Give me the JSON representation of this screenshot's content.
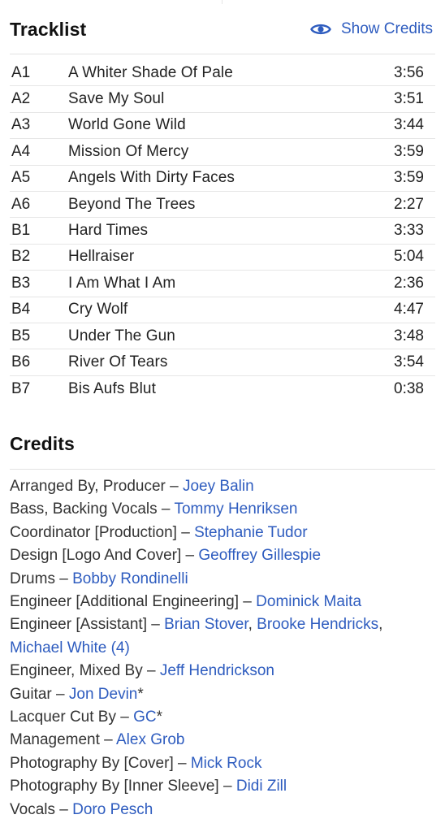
{
  "tracklist": {
    "title": "Tracklist",
    "show_credits_label": "Show Credits",
    "tracks": [
      {
        "position": "A1",
        "title": "A Whiter Shade Of Pale",
        "duration": "3:56"
      },
      {
        "position": "A2",
        "title": "Save My Soul",
        "duration": "3:51"
      },
      {
        "position": "A3",
        "title": "World Gone Wild",
        "duration": "3:44"
      },
      {
        "position": "A4",
        "title": "Mission Of Mercy",
        "duration": "3:59"
      },
      {
        "position": "A5",
        "title": "Angels With Dirty Faces",
        "duration": "3:59"
      },
      {
        "position": "A6",
        "title": "Beyond The Trees",
        "duration": "2:27"
      },
      {
        "position": "B1",
        "title": "Hard Times",
        "duration": "3:33"
      },
      {
        "position": "B2",
        "title": "Hellraiser",
        "duration": "5:04"
      },
      {
        "position": "B3",
        "title": "I Am What I Am",
        "duration": "2:36"
      },
      {
        "position": "B4",
        "title": "Cry Wolf",
        "duration": "4:47"
      },
      {
        "position": "B5",
        "title": "Under The Gun",
        "duration": "3:48"
      },
      {
        "position": "B6",
        "title": "River Of Tears",
        "duration": "3:54"
      },
      {
        "position": "B7",
        "title": "Bis Aufs Blut",
        "duration": "0:38"
      }
    ]
  },
  "credits": {
    "title": "Credits",
    "separator": " – ",
    "items": [
      {
        "role": "Arranged By, Producer",
        "names": [
          {
            "name": "Joey Balin",
            "suffix": ""
          }
        ]
      },
      {
        "role": "Bass, Backing Vocals",
        "names": [
          {
            "name": "Tommy Henriksen",
            "suffix": ""
          }
        ]
      },
      {
        "role": "Coordinator [Production]",
        "names": [
          {
            "name": "Stephanie Tudor",
            "suffix": ""
          }
        ]
      },
      {
        "role": "Design [Logo And Cover]",
        "names": [
          {
            "name": "Geoffrey Gillespie",
            "suffix": ""
          }
        ]
      },
      {
        "role": "Drums",
        "names": [
          {
            "name": "Bobby Rondinelli",
            "suffix": ""
          }
        ]
      },
      {
        "role": "Engineer [Additional Engineering]",
        "names": [
          {
            "name": "Dominick Maita",
            "suffix": ""
          }
        ]
      },
      {
        "role": "Engineer [Assistant]",
        "names": [
          {
            "name": "Brian Stover",
            "suffix": ", "
          },
          {
            "name": "Brooke Hendricks",
            "suffix": ", "
          },
          {
            "name": "Michael White (4)",
            "suffix": ""
          }
        ]
      },
      {
        "role": "Engineer, Mixed By",
        "names": [
          {
            "name": "Jeff Hendrickson",
            "suffix": ""
          }
        ]
      },
      {
        "role": "Guitar",
        "names": [
          {
            "name": "Jon Devin",
            "suffix": "*"
          }
        ]
      },
      {
        "role": "Lacquer Cut By",
        "names": [
          {
            "name": "GC",
            "suffix": "*"
          }
        ]
      },
      {
        "role": "Management",
        "names": [
          {
            "name": "Alex Grob",
            "suffix": ""
          }
        ]
      },
      {
        "role": "Photography By [Cover]",
        "names": [
          {
            "name": "Mick Rock",
            "suffix": ""
          }
        ]
      },
      {
        "role": "Photography By [Inner Sleeve]",
        "names": [
          {
            "name": "Didi Zill",
            "suffix": ""
          }
        ]
      },
      {
        "role": "Vocals",
        "names": [
          {
            "name": "Doro Pesch",
            "suffix": ""
          }
        ]
      }
    ]
  },
  "colors": {
    "link": "#2e5cbf",
    "text": "#222222",
    "divider": "#e2e2e2"
  },
  "icons": {
    "show_credits": "eye-icon"
  }
}
